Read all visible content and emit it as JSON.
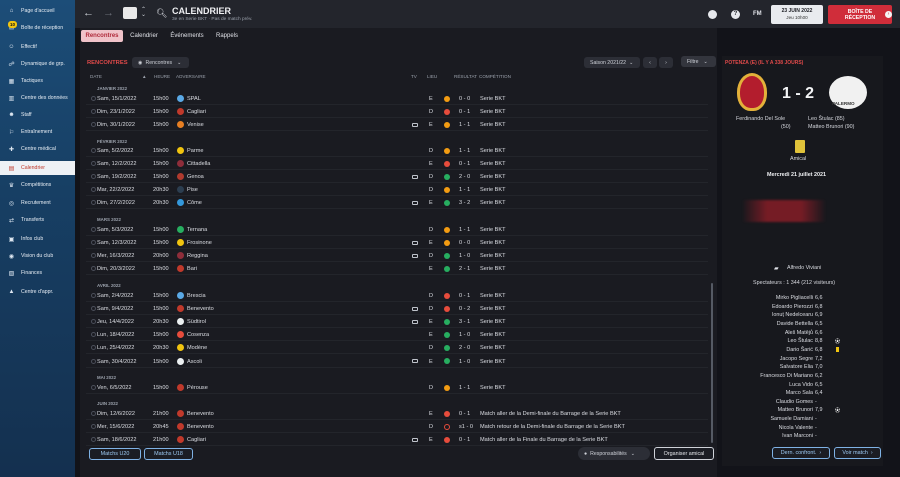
{
  "sidebar": {
    "items": [
      {
        "label": "Page d'accueil",
        "icon": "home-icon",
        "glyph": "⌂",
        "active": false
      },
      {
        "label": "Boîte de réception",
        "icon": "inbox-icon",
        "glyph": "✉",
        "active": false
      },
      {
        "label": "Effectif",
        "icon": "squad-icon",
        "glyph": "☺",
        "active": false
      },
      {
        "label": "Dynamique de grp.",
        "icon": "dynamics-icon",
        "glyph": "☍",
        "active": false
      },
      {
        "label": "Tactiques",
        "icon": "tactics-icon",
        "glyph": "▦",
        "active": false
      },
      {
        "label": "Centre des données",
        "icon": "data-icon",
        "glyph": "▥",
        "active": false
      },
      {
        "label": "Staff",
        "icon": "staff-icon",
        "glyph": "☻",
        "active": false
      },
      {
        "label": "Entraînement",
        "icon": "training-icon",
        "glyph": "⚐",
        "active": false
      },
      {
        "label": "Centre médical",
        "icon": "medical-icon",
        "glyph": "✚",
        "active": false
      },
      {
        "label": "Calendrier",
        "icon": "calendar-icon",
        "glyph": "▤",
        "active": true
      },
      {
        "label": "Compétitions",
        "icon": "trophy-icon",
        "glyph": "♛",
        "active": false
      },
      {
        "label": "Recrutement",
        "icon": "scouting-icon",
        "glyph": "◎",
        "active": false
      },
      {
        "label": "Transferts",
        "icon": "transfers-icon",
        "glyph": "⇄",
        "active": false
      },
      {
        "label": "Infos club",
        "icon": "club-info-icon",
        "glyph": "▣",
        "active": false
      },
      {
        "label": "Vision du club",
        "icon": "club-vision-icon",
        "glyph": "◉",
        "active": false
      },
      {
        "label": "Finances",
        "icon": "finances-icon",
        "glyph": "▧",
        "active": false
      },
      {
        "label": "Centre d'appr.",
        "icon": "academy-icon",
        "glyph": "▲",
        "active": false
      }
    ],
    "inbox_count": "10"
  },
  "header": {
    "title": "CALENDRIER",
    "subtitle": "3e en Serie BKT · Pas de match prév.",
    "date": "23 JUIN 2022",
    "day_time": "Jeu 10h00",
    "fm_label": "FM",
    "inbox_button": "BOÎTE DE RÉCEPTION"
  },
  "tabs": [
    "Rencontres",
    "Calendrier",
    "Événements",
    "Rappels"
  ],
  "section_title": "RENCONTRES",
  "view_dropdown": "Rencontres",
  "season_dropdown": "Saison 2021/22",
  "filter_label": "Filtre",
  "columns": {
    "date": "DATE",
    "heure": "HEURE",
    "adversaire": "ADVERSAIRE",
    "tv": "TV",
    "lieu": "LIEU",
    "resultat": "RÉSULTAT",
    "competition": "COMPÉTITION"
  },
  "groups": [
    {
      "month": "JANVIER 2022",
      "rows": [
        {
          "date": "Sam, 15/1/2022",
          "time": "15h00",
          "opp": "SPAL",
          "crest": "#5aa9e6",
          "tv": false,
          "venue": "E",
          "res": "draw",
          "score": "0 - 0",
          "comp": "Serie BKT"
        },
        {
          "date": "Dim, 23/1/2022",
          "time": "15h00",
          "opp": "Cagliari",
          "crest": "#c0392b",
          "tv": false,
          "venue": "D",
          "res": "loss",
          "score": "0 - 1",
          "comp": "Serie BKT"
        },
        {
          "date": "Dim, 30/1/2022",
          "time": "15h00",
          "opp": "Venise",
          "crest": "#e67e22",
          "tv": true,
          "venue": "E",
          "res": "draw",
          "score": "1 - 1",
          "comp": "Serie BKT"
        }
      ]
    },
    {
      "month": "FÉVRIER 2022",
      "rows": [
        {
          "date": "Sam, 5/2/2022",
          "time": "15h00",
          "opp": "Parme",
          "crest": "#f1c40f",
          "tv": false,
          "venue": "D",
          "res": "draw",
          "score": "1 - 1",
          "comp": "Serie BKT"
        },
        {
          "date": "Sam, 12/2/2022",
          "time": "15h00",
          "opp": "Cittadella",
          "crest": "#8e2d3a",
          "tv": false,
          "venue": "E",
          "res": "loss",
          "score": "0 - 1",
          "comp": "Serie BKT"
        },
        {
          "date": "Sam, 19/2/2022",
          "time": "15h00",
          "opp": "Genoa",
          "crest": "#b03a2e",
          "tv": true,
          "venue": "D",
          "res": "win",
          "score": "2 - 0",
          "comp": "Serie BKT"
        },
        {
          "date": "Mar, 22/2/2022",
          "time": "20h30",
          "opp": "Pise",
          "crest": "#2c3e50",
          "tv": false,
          "venue": "D",
          "res": "draw",
          "score": "1 - 1",
          "comp": "Serie BKT"
        },
        {
          "date": "Dim, 27/2/2022",
          "time": "20h30",
          "opp": "Côme",
          "crest": "#3498db",
          "tv": true,
          "venue": "E",
          "res": "win",
          "score": "3 - 2",
          "comp": "Serie BKT"
        }
      ]
    },
    {
      "month": "MARS 2022",
      "rows": [
        {
          "date": "Sam, 5/3/2022",
          "time": "15h00",
          "opp": "Ternana",
          "crest": "#27ae60",
          "tv": false,
          "venue": "D",
          "res": "draw",
          "score": "1 - 1",
          "comp": "Serie BKT"
        },
        {
          "date": "Sam, 12/3/2022",
          "time": "15h00",
          "opp": "Frosinone",
          "crest": "#f1c40f",
          "tv": true,
          "venue": "E",
          "res": "draw",
          "score": "0 - 0",
          "comp": "Serie BKT"
        },
        {
          "date": "Mer, 16/3/2022",
          "time": "20h00",
          "opp": "Reggina",
          "crest": "#8e2d3a",
          "tv": true,
          "venue": "D",
          "res": "win",
          "score": "1 - 0",
          "comp": "Serie BKT"
        },
        {
          "date": "Dim, 20/3/2022",
          "time": "15h00",
          "opp": "Bari",
          "crest": "#c0392b",
          "tv": false,
          "venue": "E",
          "res": "win",
          "score": "2 - 1",
          "comp": "Serie BKT"
        }
      ]
    },
    {
      "month": "AVRIL 2022",
      "rows": [
        {
          "date": "Sam, 2/4/2022",
          "time": "15h00",
          "opp": "Brescia",
          "crest": "#5aa9e6",
          "tv": false,
          "venue": "D",
          "res": "loss",
          "score": "0 - 1",
          "comp": "Serie BKT"
        },
        {
          "date": "Sam, 9/4/2022",
          "time": "15h00",
          "opp": "Benevento",
          "crest": "#c0392b",
          "tv": true,
          "venue": "D",
          "res": "loss",
          "score": "0 - 2",
          "comp": "Serie BKT"
        },
        {
          "date": "Jeu, 14/4/2022",
          "time": "20h30",
          "opp": "Südtirol",
          "crest": "#ecf0f1",
          "tv": true,
          "venue": "E",
          "res": "win",
          "score": "3 - 1",
          "comp": "Serie BKT"
        },
        {
          "date": "Lun, 18/4/2022",
          "time": "15h00",
          "opp": "Cosenza",
          "crest": "#e74c3c",
          "tv": false,
          "venue": "E",
          "res": "win",
          "score": "1 - 0",
          "comp": "Serie BKT"
        },
        {
          "date": "Lun, 25/4/2022",
          "time": "20h30",
          "opp": "Modène",
          "crest": "#f1c40f",
          "tv": false,
          "venue": "D",
          "res": "win",
          "score": "2 - 0",
          "comp": "Serie BKT"
        },
        {
          "date": "Sam, 30/4/2022",
          "time": "15h00",
          "opp": "Ascoli",
          "crest": "#ecf0f1",
          "tv": true,
          "venue": "E",
          "res": "win",
          "score": "1 - 0",
          "comp": "Serie BKT"
        }
      ]
    },
    {
      "month": "MAI 2022",
      "rows": [
        {
          "date": "Ven, 6/5/2022",
          "time": "15h00",
          "opp": "Pérouse",
          "crest": "#c0392b",
          "tv": false,
          "venue": "D",
          "res": "draw",
          "score": "1 - 1",
          "comp": "Serie BKT"
        }
      ]
    },
    {
      "month": "JUIN 2022",
      "rows": [
        {
          "date": "Dim, 12/6/2022",
          "time": "21h00",
          "opp": "Benevento",
          "crest": "#c0392b",
          "tv": false,
          "venue": "E",
          "res": "loss",
          "score": "0 - 1",
          "comp": "Match aller de la Demi-finale du Barrage de la Serie BKT"
        },
        {
          "date": "Mer, 15/6/2022",
          "time": "20h45",
          "opp": "Benevento",
          "crest": "#c0392b",
          "tv": false,
          "venue": "D",
          "res": "none",
          "score": "s1 - 0",
          "comp": "Match retour de la Demi-finale du Barrage de la Serie BKT"
        },
        {
          "date": "Sam, 18/6/2022",
          "time": "21h00",
          "opp": "Cagliari",
          "crest": "#c0392b",
          "tv": true,
          "venue": "E",
          "res": "loss",
          "score": "0 - 1",
          "comp": "Match aller de la Finale du Barrage de la Serie BKT"
        }
      ]
    }
  ],
  "bottom": {
    "u20": "Matchs U20",
    "u18": "Matchs U18",
    "resp": "Responsabilités",
    "friendly": "Organiser amical"
  },
  "match": {
    "header": "POTENZA (E) (IL Y A 338 JOURS)",
    "score": "1 - 2",
    "home_scorer": "Ferdinando Del Sole",
    "home_minute": "(50)",
    "away_scorer1": "Leo Štulac (85)",
    "away_scorer2": "Matteo Brunori (90)",
    "away_name": "PALERMO",
    "comp": "Amical",
    "date": "Mercredi 21 juillet 2021",
    "referee": "Alfredo Viviani",
    "spectators": "Spectateurs : 1 344 (212 visiteurs)",
    "players": [
      {
        "n": "Mirko Pigliacelli",
        "r": "6,6",
        "m": ""
      },
      {
        "n": "Edoardo Pierozzi",
        "r": "6,8",
        "m": ""
      },
      {
        "n": "Ionuț Nedelcearu",
        "r": "6,9",
        "m": ""
      },
      {
        "n": "Davide Bettella",
        "r": "6,5",
        "m": ""
      },
      {
        "n": "Aleš Matějů",
        "r": "6,6",
        "m": ""
      },
      {
        "n": "Leo Štulac",
        "r": "8,8",
        "m": "ball"
      },
      {
        "n": "Dario Šarić",
        "r": "6,8",
        "m": "card"
      },
      {
        "n": "Jacopo Segre",
        "r": "7,2",
        "m": ""
      },
      {
        "n": "Salvatore Elia",
        "r": "7,0",
        "m": ""
      },
      {
        "n": "Francesco Di Mariano",
        "r": "6,2",
        "m": ""
      },
      {
        "n": "Luca Vido",
        "r": "6,5",
        "m": ""
      },
      {
        "n": "Marco Sala",
        "r": "6,4",
        "m": ""
      },
      {
        "n": "Claudio Gomes",
        "r": "-",
        "m": ""
      },
      {
        "n": "Matteo Brunori",
        "r": "7,9",
        "m": "ball"
      },
      {
        "n": "Samuele Damiani",
        "r": "-",
        "m": ""
      },
      {
        "n": "Nicola Valente",
        "r": "-",
        "m": ""
      },
      {
        "n": "Ivan Marconi",
        "r": "-",
        "m": ""
      }
    ],
    "btn_confront": "Dern. confront.",
    "btn_match": "Voir match"
  }
}
